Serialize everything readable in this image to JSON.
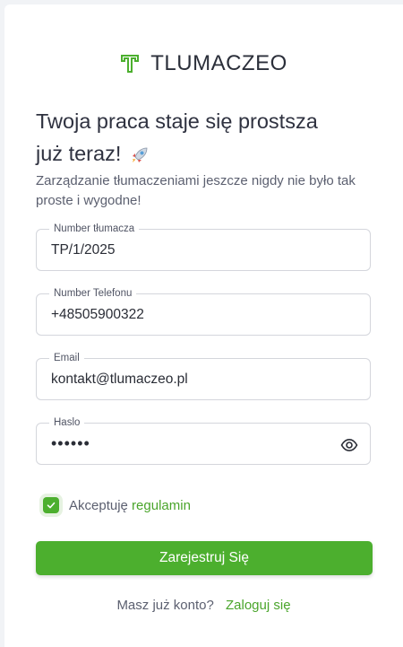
{
  "brand": {
    "name": "TLUMACZEO",
    "color": "#4caf2e"
  },
  "headline": {
    "line1": "Twoja praca staje się prostsza",
    "line2": "już teraz!",
    "emoji": "rocket-icon"
  },
  "subtitle": "Zarządzanie tłumaczeniami jeszcze nigdy nie było tak proste i wygodne!",
  "fields": [
    {
      "label": "Number tłumacza",
      "value": "TP/1/2025"
    },
    {
      "label": "Number Telefonu",
      "value": "+48505900322"
    },
    {
      "label": "Email",
      "value": "kontakt@tlumaczeo.pl"
    },
    {
      "label": "Haslo",
      "value": "••••••"
    }
  ],
  "terms": {
    "checked": true,
    "text": "Akceptuję",
    "link": "regulamin"
  },
  "submit_label": "Zarejestruj Się",
  "login": {
    "prompt": "Masz już konto?",
    "link": "Zaloguj się"
  },
  "colors": {
    "accent": "#4caf2e",
    "link": "#4aa52b",
    "text": "#2f3240",
    "muted": "#5c6070"
  }
}
